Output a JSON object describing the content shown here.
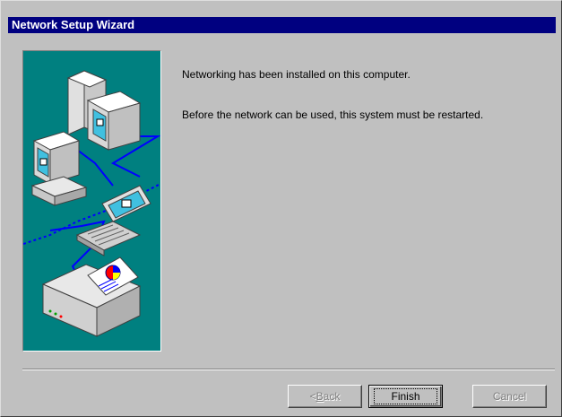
{
  "window": {
    "title": "Network Setup Wizard"
  },
  "messages": {
    "installed": "Networking has been installed on this computer.",
    "restart": "Before the network can be used, this system must be restarted."
  },
  "buttons": {
    "back": {
      "accel": "B",
      "rest": "ack",
      "prefix": "< "
    },
    "finish": "Finish",
    "cancel": "Cancel"
  },
  "illustration": {
    "icon": "network-computers-illustration"
  },
  "colors": {
    "title_bar": "#000080",
    "dialog_face": "#c0c0c0",
    "illustration_bg": "#008080",
    "network_cable": "#0000ff"
  }
}
